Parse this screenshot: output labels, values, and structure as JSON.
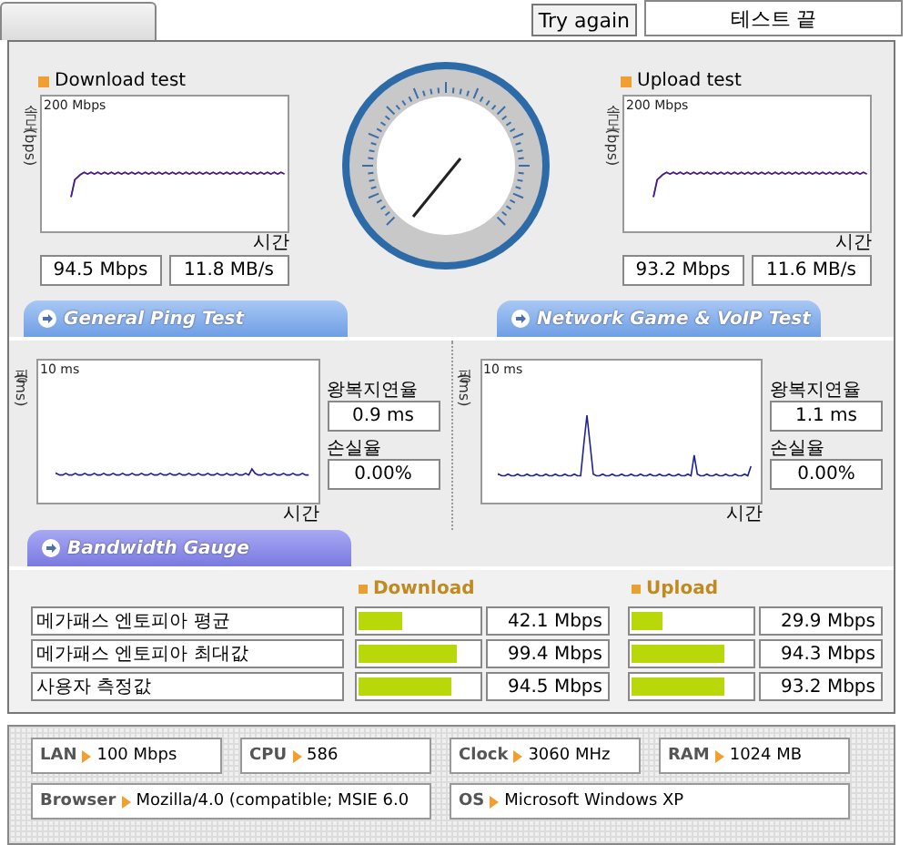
{
  "header": {
    "button": "Try again",
    "status": "테스트 끝"
  },
  "speed_tests": [
    {
      "title": "Download test",
      "y_axis": "속도 (bps)",
      "scale": "200 Mbps",
      "x_axis": "시간",
      "readings": [
        "94.5 Mbps",
        "11.8 MB/s"
      ]
    },
    {
      "title": "Upload test",
      "y_axis": "속도 (bps)",
      "scale": "200 Mbps",
      "x_axis": "시간",
      "readings": [
        "93.2 Mbps",
        "11.6 MB/s"
      ]
    }
  ],
  "ping_tests": [
    {
      "title": "General Ping Test",
      "y_axis": "핑(ms)",
      "scale": "10 ms",
      "x_axis": "시간",
      "latency_label": "왕복지연율",
      "latency": "0.9 ms",
      "loss_label": "손실율",
      "loss": "0.00%"
    },
    {
      "title": "Network Game & VoIP Test",
      "y_axis": "핑(ms)",
      "scale": "10 ms",
      "x_axis": "시간",
      "latency_label": "왕복지연율",
      "latency": "1.1 ms",
      "loss_label": "손실율",
      "loss": "0.00%"
    }
  ],
  "bandwidth": {
    "title": "Bandwidth Gauge",
    "columns": [
      "Download",
      "Upload"
    ],
    "rows": [
      {
        "label": "메가패스 엔토피아 평균",
        "download": {
          "level": 0.37,
          "value": "42.1 Mbps"
        },
        "upload": {
          "level": 0.25,
          "value": "29.9 Mbps"
        }
      },
      {
        "label": "메가패스 엔토피아 최대값",
        "download": {
          "level": 0.82,
          "value": "99.4 Mbps"
        },
        "upload": {
          "level": 0.78,
          "value": "94.3 Mbps"
        }
      },
      {
        "label": "사용자 측정값",
        "download": {
          "level": 0.78,
          "value": "94.5 Mbps"
        },
        "upload": {
          "level": 0.77,
          "value": "93.2 Mbps"
        }
      }
    ]
  },
  "system_info": [
    {
      "label": "LAN",
      "value": "100 Mbps"
    },
    {
      "label": "CPU",
      "value": "586"
    },
    {
      "label": "Clock",
      "value": "3060 MHz"
    },
    {
      "label": "RAM",
      "value": "1024 MB"
    },
    {
      "label": "Browser",
      "value": "Mozilla/4.0 (compatible; MSIE 6.0"
    },
    {
      "label": "OS",
      "value": "Microsoft Windows XP"
    }
  ]
}
